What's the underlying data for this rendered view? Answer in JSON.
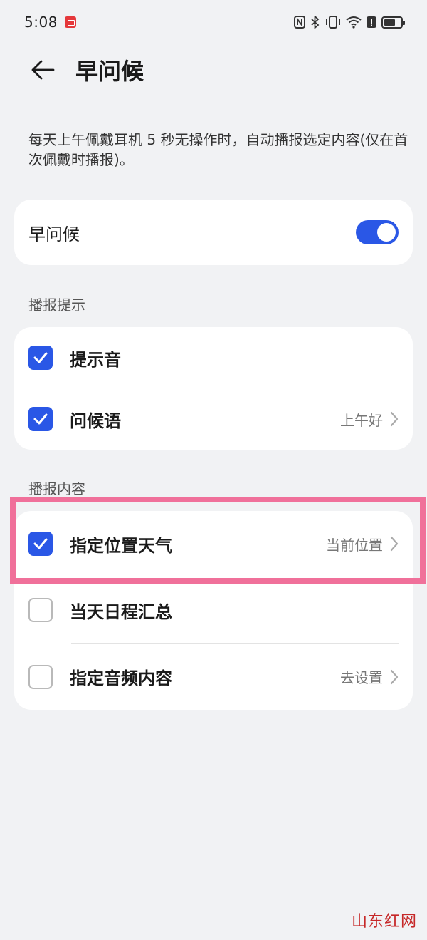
{
  "status_bar": {
    "time": "5:08",
    "icons": [
      "notification-app-icon",
      "nfc-icon",
      "bluetooth-icon",
      "vibrate-icon",
      "wifi-icon",
      "alert-icon",
      "battery-icon"
    ]
  },
  "header": {
    "back_icon": "arrow-left-icon",
    "title": "早问候"
  },
  "description": "每天上午佩戴耳机 5 秒无操作时，自动播报选定内容(仅在首次佩戴时播报)。",
  "main_toggle": {
    "label": "早问候",
    "enabled": true
  },
  "section_prompt": {
    "title": "播报提示",
    "items": [
      {
        "label": "提示音",
        "checked": true,
        "value": ""
      },
      {
        "label": "问候语",
        "checked": true,
        "value": "上午好"
      }
    ]
  },
  "section_content": {
    "title": "播报内容",
    "items": [
      {
        "label": "指定位置天气",
        "checked": true,
        "value": "当前位置"
      },
      {
        "label": "当天日程汇总",
        "checked": false,
        "value": ""
      },
      {
        "label": "指定音频内容",
        "checked": false,
        "value": "去设置"
      }
    ]
  },
  "watermark": "山东红网",
  "colors": {
    "accent": "#2a57e6",
    "background": "#f1f2f4",
    "highlight": "#f0709a",
    "watermark": "#c62828"
  }
}
